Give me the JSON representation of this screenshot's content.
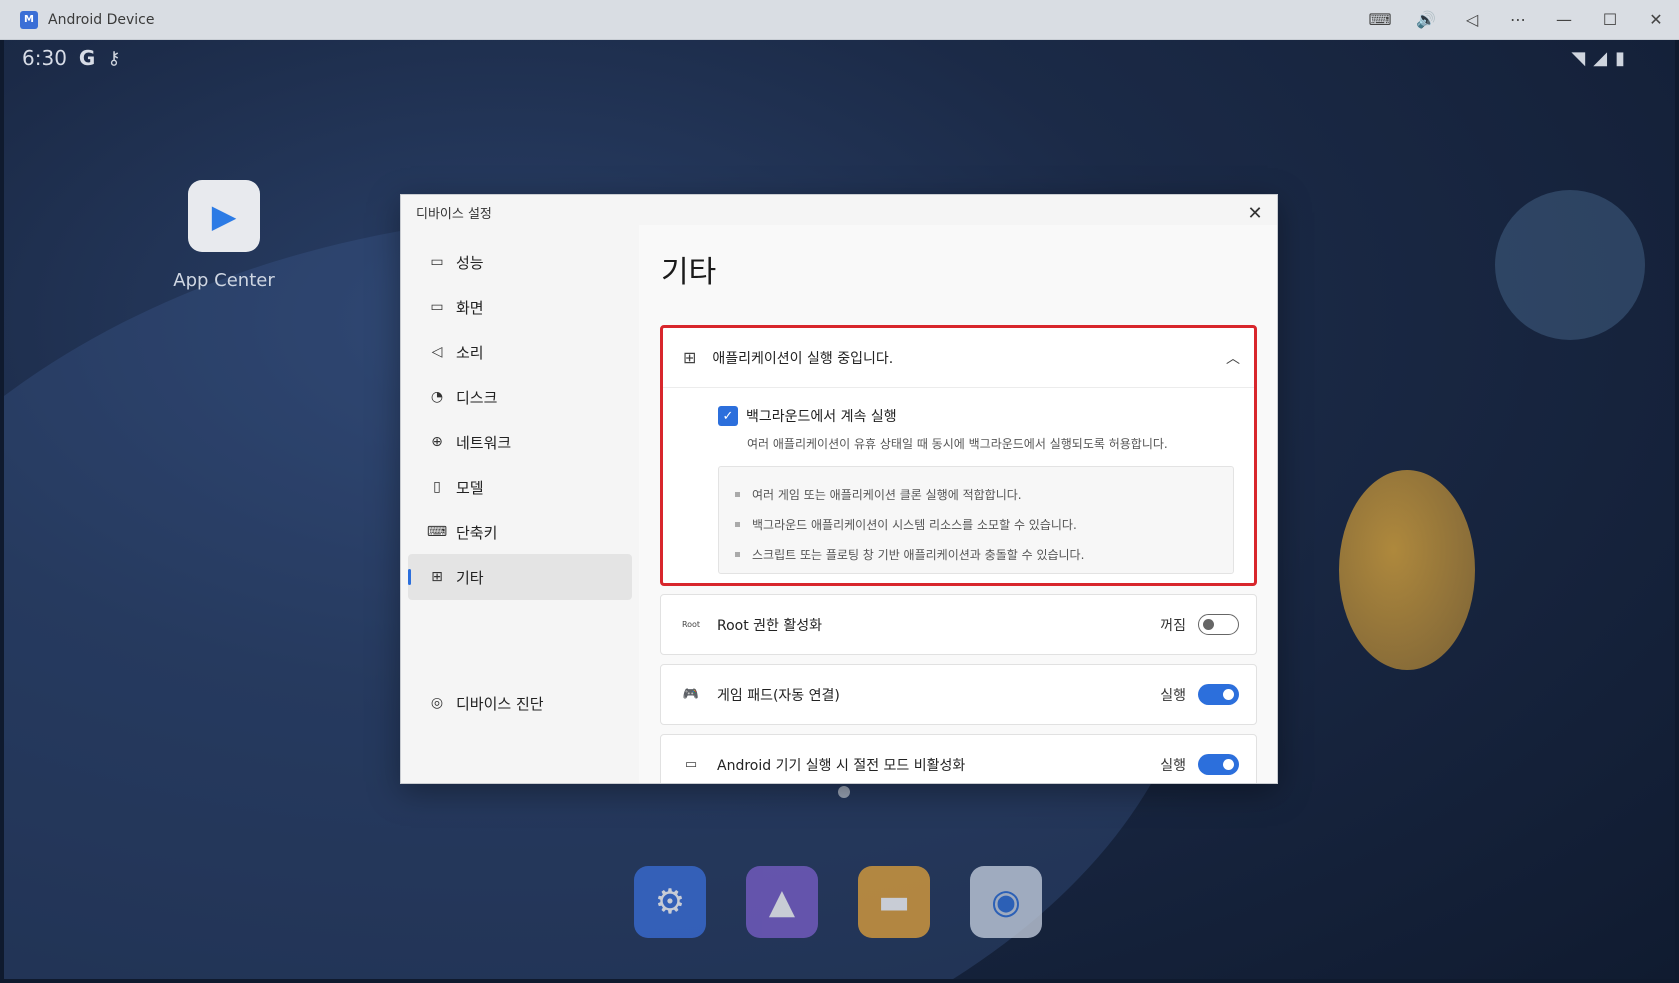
{
  "window": {
    "title": "Android Device",
    "app_icon": "android-device-app-icon",
    "controls": [
      {
        "name": "keyboard-icon",
        "glyph": "⌨"
      },
      {
        "name": "volume-icon",
        "glyph": "🔊"
      },
      {
        "name": "back-icon",
        "glyph": "◁"
      },
      {
        "name": "more-icon",
        "glyph": "⋯"
      },
      {
        "name": "minimize-icon",
        "glyph": "—"
      },
      {
        "name": "maximize-icon",
        "glyph": "☐"
      },
      {
        "name": "close-icon",
        "glyph": "✕"
      }
    ]
  },
  "statusbar": {
    "time": "6:30",
    "g_label": "G"
  },
  "desktop": {
    "app_center_label": "App Center"
  },
  "dialog": {
    "header_title": "디바이스 설정",
    "close_glyph": "✕",
    "nav": [
      {
        "label": "성능",
        "icon": "performance-icon",
        "glyph": "▭"
      },
      {
        "label": "화면",
        "icon": "display-icon",
        "glyph": "▭"
      },
      {
        "label": "소리",
        "icon": "sound-icon",
        "glyph": "◁"
      },
      {
        "label": "디스크",
        "icon": "disk-icon",
        "glyph": "◔"
      },
      {
        "label": "네트워크",
        "icon": "network-icon",
        "glyph": "⊕"
      },
      {
        "label": "모델",
        "icon": "model-icon",
        "glyph": "▯"
      },
      {
        "label": "단축키",
        "icon": "shortcut-icon",
        "glyph": "⌨"
      },
      {
        "label": "기타",
        "icon": "other-icon",
        "glyph": "⊞",
        "active": true
      }
    ],
    "diagnostics_label": "디바이스 진단",
    "content_title": "기타",
    "group": {
      "title": "애플리케이션이 실행 중입니다.",
      "checkbox_label": "백그라운드에서 계속 실행",
      "checkbox_checked": true,
      "description": "여러 애플리케이션이 유휴 상태일 때 동시에 백그라운드에서 실행되도록 허용합니다.",
      "notes": [
        "여러 게임 또는 애플리케이션 클론 실행에 적합합니다.",
        "백그라운드 애플리케이션이 시스템 리소스를 소모할 수 있습니다.",
        "스크립트 또는 플로팅 창 기반 애플리케이션과 충돌할 수 있습니다."
      ]
    },
    "rows": [
      {
        "label": "Root 권한 활성화",
        "state": "꺼짐",
        "on": false,
        "icon": "root-icon",
        "glyph": "Root"
      },
      {
        "label": "게임 패드(자동 연결)",
        "state": "실행",
        "on": true,
        "icon": "gamepad-icon",
        "glyph": "🎮"
      },
      {
        "label": "Android 기기 실행 시 절전 모드 비활성화",
        "state": "실행",
        "on": true,
        "icon": "power-save-icon",
        "glyph": "▭"
      }
    ]
  },
  "colors": {
    "accent": "#2c6fdc",
    "highlight_border": "#d8262c"
  }
}
